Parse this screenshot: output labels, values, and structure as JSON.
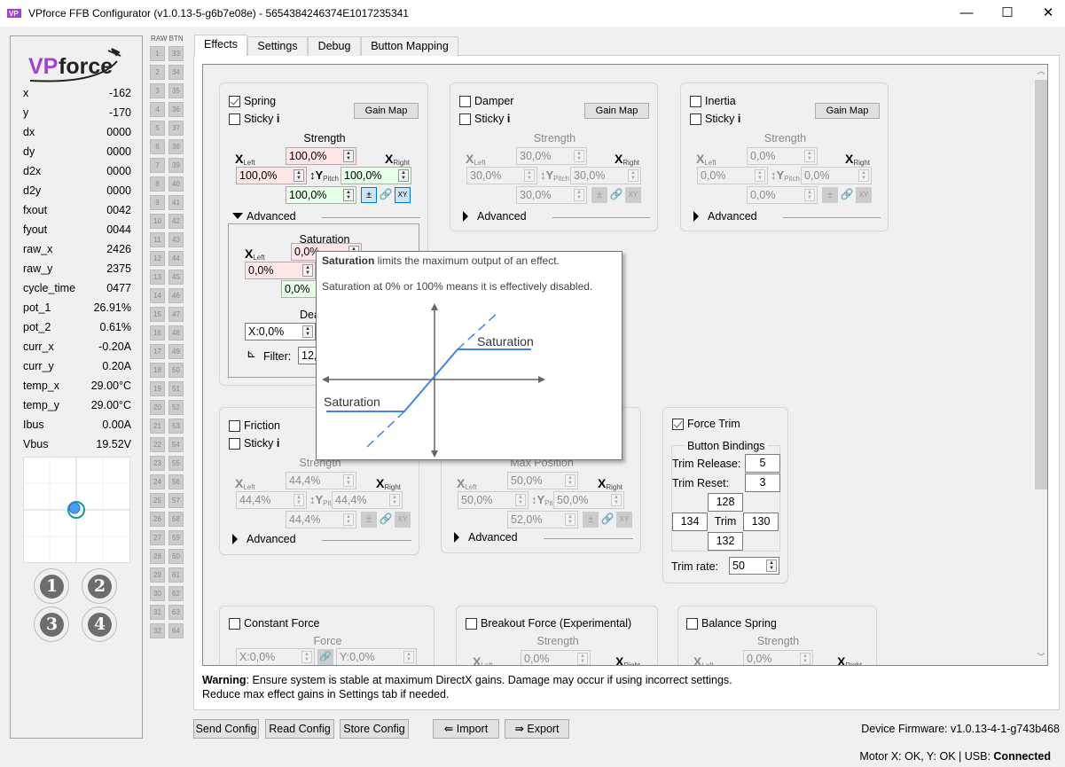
{
  "window": {
    "title": "VPforce FFB Configurator (v1.0.13-5-g6b7e08e) - 5654384246374E1017235341",
    "icon": "vpforce-app-icon",
    "minimize": "—",
    "maximize": "☐",
    "close": "✕"
  },
  "logo": {
    "text_vp": "VP",
    "text_force": "force"
  },
  "stats": [
    {
      "label": "x",
      "value": "-162"
    },
    {
      "label": "y",
      "value": "-170"
    },
    {
      "label": "dx",
      "value": "0000"
    },
    {
      "label": "dy",
      "value": "0000"
    },
    {
      "label": "d2x",
      "value": "0000"
    },
    {
      "label": "d2y",
      "value": "0000"
    },
    {
      "label": "fxout",
      "value": "0042"
    },
    {
      "label": "fyout",
      "value": "0044"
    },
    {
      "label": "raw_x",
      "value": "2426"
    },
    {
      "label": "raw_y",
      "value": "2375"
    },
    {
      "label": "cycle_time",
      "value": "0477"
    },
    {
      "label": "pot_1",
      "value": "26.91%"
    },
    {
      "label": "pot_2",
      "value": "0.61%"
    },
    {
      "label": "curr_x",
      "value": "-0.20A"
    },
    {
      "label": "curr_y",
      "value": "0.20A"
    },
    {
      "label": "temp_x",
      "value": "29.00°C"
    },
    {
      "label": "temp_y",
      "value": "29.00°C"
    },
    {
      "label": "Ibus",
      "value": "0.00A"
    },
    {
      "label": "Vbus",
      "value": "19.52V"
    }
  ],
  "joystick_buttons": [
    "1",
    "2",
    "3",
    "4"
  ],
  "raw_btn": {
    "header": "RAW BTN",
    "count": 64
  },
  "tabs": [
    {
      "label": "Effects",
      "active": true
    },
    {
      "label": "Settings",
      "active": false
    },
    {
      "label": "Debug",
      "active": false
    },
    {
      "label": "Button Mapping",
      "active": false
    }
  ],
  "axis": {
    "x": "X",
    "left": "Left",
    "right": "Right",
    "y": "Y",
    "pitch": "Pitch",
    "pm": "±",
    "xy": "XY"
  },
  "effects": [
    {
      "id": "spring",
      "label": "Spring",
      "checked": true,
      "sticky": "Sticky",
      "gain_map": "Gain Map",
      "strength_label": "Strength",
      "top": "100,0%",
      "left": "100,0%",
      "right": "100,0%",
      "bottom": "100,0%",
      "enabled": true,
      "advanced": "Advanced",
      "expanded": true,
      "adv": {
        "saturation_label": "Saturation",
        "top": "0,0%",
        "left": "0,0%",
        "bottom": "0,0%",
        "deadzone_label": "Dea",
        "deadzone_x": "X:0,0%",
        "filter_label": "Filter:",
        "filter_value": "12,"
      }
    },
    {
      "id": "damper",
      "label": "Damper",
      "checked": false,
      "sticky": "Sticky",
      "gain_map": "Gain Map",
      "strength_label": "Strength",
      "top": "30,0%",
      "left": "30,0%",
      "right": "30,0%",
      "bottom": "30,0%",
      "enabled": false,
      "advanced": "Advanced",
      "expanded": false
    },
    {
      "id": "inertia",
      "label": "Inertia",
      "checked": false,
      "sticky": "Sticky",
      "gain_map": "Gain Map",
      "strength_label": "Strength",
      "top": "0,0%",
      "left": "0,0%",
      "right": "0,0%",
      "bottom": "0,0%",
      "enabled": false,
      "advanced": "Advanced",
      "expanded": false
    },
    {
      "id": "friction",
      "label": "Friction",
      "checked": false,
      "sticky": "Sticky",
      "strength_label": "Strength",
      "top": "44,4%",
      "left": "44,4%",
      "right": "44,4%",
      "bottom": "44,4%",
      "enabled": false,
      "advanced": "Advanced",
      "expanded": false
    },
    {
      "id": "max-position",
      "strength_label": "Max Position",
      "top": "50,0%",
      "left": "50,0%",
      "right": "50,0%",
      "bottom": "52,0%",
      "enabled": false,
      "advanced": "Advanced",
      "expanded": false
    }
  ],
  "force_trim": {
    "label": "Force Trim",
    "checked": true,
    "group": "Button Bindings",
    "release_label": "Trim Release:",
    "release": "5",
    "reset_label": "Trim Reset:",
    "reset": "3",
    "up": "128",
    "left": "134",
    "center": "Trim",
    "right": "130",
    "down": "132",
    "rate_label": "Trim rate:",
    "rate": "50"
  },
  "constant_force": {
    "label": "Constant Force",
    "checked": false,
    "force_label": "Force",
    "x": "X:0,0%",
    "y": "Y:0,0%"
  },
  "breakout": {
    "label": "Breakout Force (Experimental)",
    "checked": false,
    "strength_label": "Strength",
    "value": "0,0%"
  },
  "balance": {
    "label": "Balance Spring",
    "checked": false,
    "strength_label": "Strength",
    "value": "0,0%"
  },
  "tooltip": {
    "title_bold": "Saturation",
    "title_rest": " limits the maximum output of an effect.",
    "line2": "Saturation at 0% or 100% means it is effectively disabled.",
    "graph_label_top": "Saturation",
    "graph_label_bottom": "Saturation",
    "line_color": "#3d85f0"
  },
  "warning": {
    "bold": "Warning",
    "line1": ": Ensure system is stable at maximum DirectX gains. Damage may occur if using incorrect settings.",
    "line2": "Reduce max effect gains in Settings tab if needed."
  },
  "buttons": {
    "send": "Send Config",
    "read": "Read Config",
    "store": "Store Config",
    "import": "Import",
    "export": "Export"
  },
  "firmware": "Device Firmware:  v1.0.13-4-1-g743b468",
  "status": {
    "motor": "Motor X: OK, Y: OK | USB: ",
    "usb": "Connected"
  },
  "colors": {
    "accent": "#0078d7",
    "logo_purple": "#a33fd1",
    "pink": "#ffe6e6",
    "green": "#e6ffe6"
  }
}
